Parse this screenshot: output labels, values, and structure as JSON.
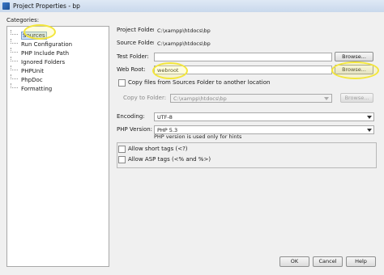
{
  "window": {
    "title": "Project Properties - bp"
  },
  "categories": {
    "label": "Categories:",
    "items": [
      {
        "label": "Sources",
        "selected": true
      },
      {
        "label": "Run Configuration"
      },
      {
        "label": "PHP Include Path"
      },
      {
        "label": "Ignored Folders"
      },
      {
        "label": "PHPUnit"
      },
      {
        "label": "PhpDoc"
      },
      {
        "label": "Formatting"
      }
    ]
  },
  "sources": {
    "project_folder": {
      "label": "Project Folder:",
      "value": "C:\\xampp\\htdocs\\bp"
    },
    "source_folder": {
      "label": "Source Folder:",
      "value": "C:\\xampp\\htdocs\\bp"
    },
    "test_folder": {
      "label": "Test Folder:",
      "value": "",
      "browse_label": "Browse..."
    },
    "web_root": {
      "label": "Web Root:",
      "value": "webroot",
      "browse_label": "Browse..."
    },
    "copy_files": {
      "label": "Copy files from Sources Folder to another location",
      "checked": false
    },
    "copy_to_folder": {
      "label": "Copy to Folder:",
      "value": "C:\\xampp\\htdocs\\bp",
      "browse_label": "Browse..."
    },
    "encoding": {
      "label": "Encoding:",
      "value": "UTF-8"
    },
    "php_version": {
      "label": "PHP Version:",
      "value": "PHP 5.3",
      "hint": "PHP version is used only for hints"
    },
    "short_tags": {
      "label": "Allow short tags (<?)",
      "checked": false
    },
    "asp_tags": {
      "label": "Allow ASP tags (<% and %>)",
      "checked": false
    }
  },
  "footer": {
    "ok_label": "OK",
    "cancel_label": "Cancel",
    "help_label": "Help"
  },
  "colors": {
    "highlight": "#f3e63b",
    "selection": "#cfe3fb"
  }
}
